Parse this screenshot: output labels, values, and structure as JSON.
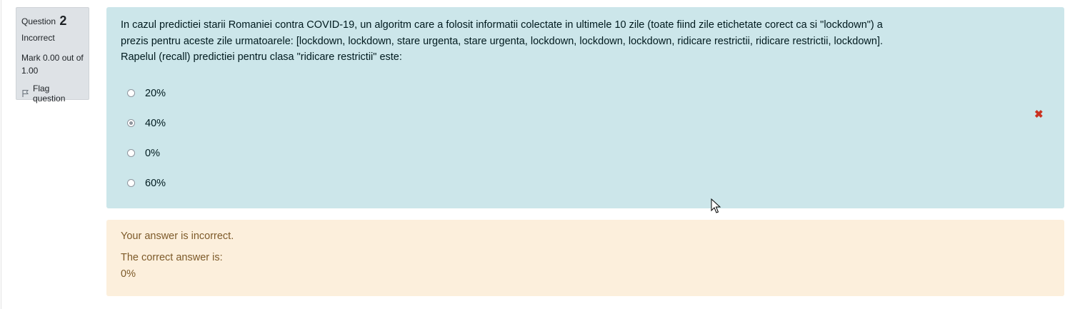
{
  "info": {
    "question_label": "Question",
    "question_number": "2",
    "state": "Incorrect",
    "grade": "Mark 0.00 out of 1.00",
    "flag_label": "Flag question"
  },
  "question": {
    "text": "In cazul predictiei starii Romaniei contra COVID-19, un algoritm care a folosit informatii colectate in ultimele 10 zile (toate fiind zile etichetate corect ca si \"lockdown\") a prezis pentru aceste zile urmatoarele: [lockdown, lockdown, stare urgenta, stare urgenta, lockdown, lockdown, lockdown, ridicare restrictii, ridicare restrictii, lockdown]. Rapelul (recall) predictiei pentru clasa \"ridicare restrictii\" este:",
    "answers": [
      {
        "label": "20%",
        "selected": false
      },
      {
        "label": "40%",
        "selected": true
      },
      {
        "label": "0%",
        "selected": false
      },
      {
        "label": "60%",
        "selected": false
      }
    ],
    "wrong_icon": "close-icon"
  },
  "outcome": {
    "feedback": "Your answer is incorrect.",
    "correct_label": "The correct answer is:",
    "correct_value": "0%"
  },
  "colors": {
    "formulation_bg": "#cce6ea",
    "outcome_bg": "#fcefdc",
    "incorrect_mark": "#ca3120"
  }
}
